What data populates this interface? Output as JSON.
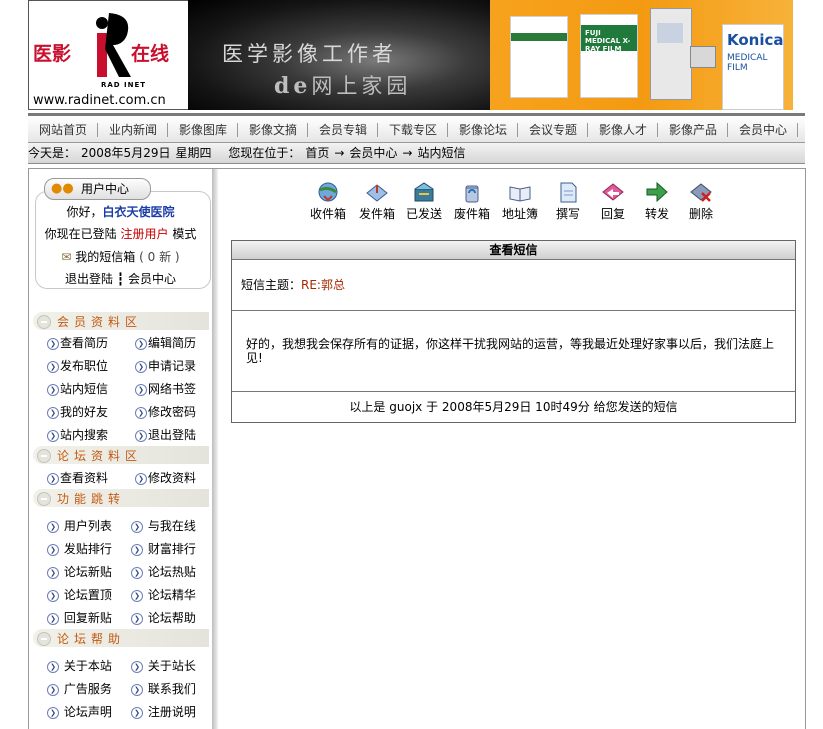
{
  "header": {
    "logo_left": "医影",
    "logo_right": "在线",
    "logo_sub": "RAD INET",
    "logo_url": "www.radinet.com.cn",
    "tagline_line1": "医学影像工作者",
    "tagline_line2_prefix": "de",
    "tagline_line2_rest": "网上家园",
    "ad_brand": "Konica",
    "ad_brand_sub": "MEDICAL FILM",
    "ad_box_text": "FUJI MEDICAL X-RAY FILM"
  },
  "nav": {
    "items": [
      "网站首页",
      "业内新闻",
      "影像图库",
      "影像文摘",
      "会员专辑",
      "下载专区",
      "影像论坛",
      "会议专题",
      "影像人才",
      "影像产品",
      "会员中心"
    ]
  },
  "location": {
    "today_label": "今天是：",
    "date": "2008年5月29日",
    "weekday": "星期四",
    "you_are_at": "您现在位于：",
    "crumbs": [
      "首页",
      "会员中心",
      "站内短信"
    ],
    "arrow": "→"
  },
  "user_center": {
    "title": "用户中心",
    "greeting": "你好，",
    "username": "白衣天使医院",
    "login_status_prefix": "你现在已登陆",
    "user_type": "注册用户",
    "mode_suffix": "模式",
    "mailbox_label": "我的短信箱",
    "mailbox_count": "( 0 新 )",
    "logout_label": "退出登陆",
    "separator": "┇",
    "member_center_label": "会员中心"
  },
  "sidebar": {
    "section_member": "会员资料区",
    "member_items": [
      "查看简历",
      "编辑简历",
      "发布职位",
      "申请记录",
      "站内短信",
      "网络书签",
      "我的好友",
      "修改密码",
      "站内搜索",
      "退出登陆"
    ],
    "section_forum": "论坛资料区",
    "forum_items": [
      "查看资料",
      "修改资料"
    ],
    "section_jump": "功能跳转",
    "jump_items": [
      "用户列表",
      "与我在线",
      "发贴排行",
      "财富排行",
      "论坛新贴",
      "论坛热贴",
      "论坛置顶",
      "论坛精华",
      "回复新贴",
      "论坛帮助"
    ],
    "section_help": "论坛帮助",
    "help_items": [
      "关于本站",
      "关于站长",
      "广告服务",
      "联系我们",
      "论坛声明",
      "注册说明"
    ]
  },
  "toolbar": {
    "items": [
      "收件箱",
      "发件箱",
      "已发送",
      "废件箱",
      "地址簿",
      "撰写",
      "回复",
      "转发",
      "删除"
    ]
  },
  "message": {
    "header": "查看短信",
    "subject_label": "短信主题：",
    "subject": "RE:郭总",
    "body": "好的，我想我会保存所有的证据，你这样干扰我网站的运营，等我最近处理好家事以后，我们法庭上见!",
    "footer_prefix": "以上是",
    "footer_sender": "guojx",
    "footer_mid": "于",
    "footer_date": "2008年5月29日 10时49分",
    "footer_suffix": "给您发送的短信"
  },
  "colors": {
    "accent_red": "#c8102e",
    "section_text": "#c45a12",
    "username_blue": "#1a3ca8",
    "subject_red": "#a52a00"
  }
}
